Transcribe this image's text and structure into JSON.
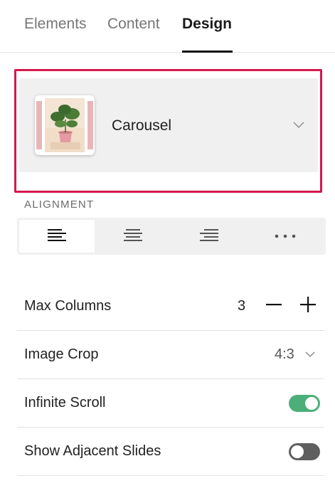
{
  "tabs": [
    {
      "label": "Elements",
      "active": false
    },
    {
      "label": "Content",
      "active": false
    },
    {
      "label": "Design",
      "active": true
    }
  ],
  "layout": {
    "label": "Carousel",
    "thumbnail_icon": "carousel-plant-thumbnail",
    "chevron_icon": "chevron-down-icon"
  },
  "alignment": {
    "section_label": "ALIGNMENT",
    "options": [
      {
        "name": "align-left-icon",
        "active": true
      },
      {
        "name": "align-center-icon",
        "active": false
      },
      {
        "name": "align-right-icon",
        "active": false
      },
      {
        "name": "more-options-icon",
        "active": false
      }
    ]
  },
  "settings": {
    "max_columns": {
      "label": "Max Columns",
      "value": "3"
    },
    "image_crop": {
      "label": "Image Crop",
      "value": "4:3"
    },
    "infinite_scroll": {
      "label": "Infinite Scroll",
      "enabled": true
    },
    "show_adjacent_slides": {
      "label": "Show Adjacent Slides",
      "enabled": false
    }
  },
  "colors": {
    "highlight_border": "#d6174c",
    "toggle_on": "#4caf7a",
    "toggle_off": "#5f5f5f",
    "control_background": "#f0f0f0"
  }
}
